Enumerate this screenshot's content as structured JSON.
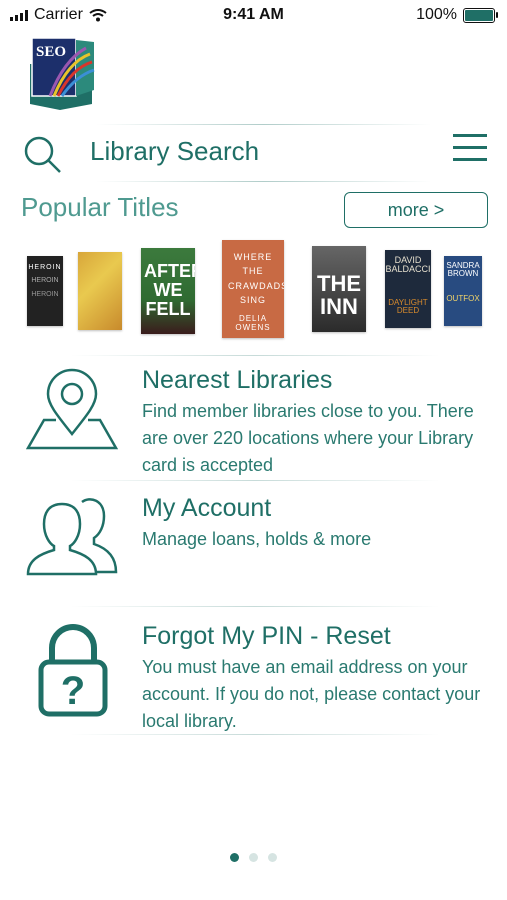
{
  "status_bar": {
    "carrier": "Carrier",
    "time": "9:41 AM",
    "battery": "100%"
  },
  "logo": {
    "text": "SEO"
  },
  "search": {
    "placeholder": "Library Search"
  },
  "popular": {
    "title": "Popular Titles",
    "more_label": "more >",
    "books": [
      {
        "text": "HEROIN"
      },
      {
        "text": ""
      },
      {
        "text": "AFTER WE FELL"
      },
      {
        "text": "WHERE THE CRAWDADS SING",
        "author": "DELIA OWENS"
      },
      {
        "text": "THE INN"
      },
      {
        "text": "DAVID BALDACCI",
        "author": "DAYLIGHT DEED"
      },
      {
        "text": "SANDRA BROWN",
        "author": "OUTFOX"
      }
    ]
  },
  "features": [
    {
      "title": "Nearest Libraries",
      "desc": "Find member libraries close to you. There are over 220 locations where your Library card is accepted"
    },
    {
      "title": "My Account",
      "desc": "Manage loans, holds & more"
    },
    {
      "title": "Forgot My PIN - Reset",
      "desc": "You must have an email address on your account. If you do not, please contact your local library."
    }
  ],
  "pager": {
    "count": 3,
    "active": 0
  },
  "colors": {
    "accent": "#1f6f66"
  }
}
